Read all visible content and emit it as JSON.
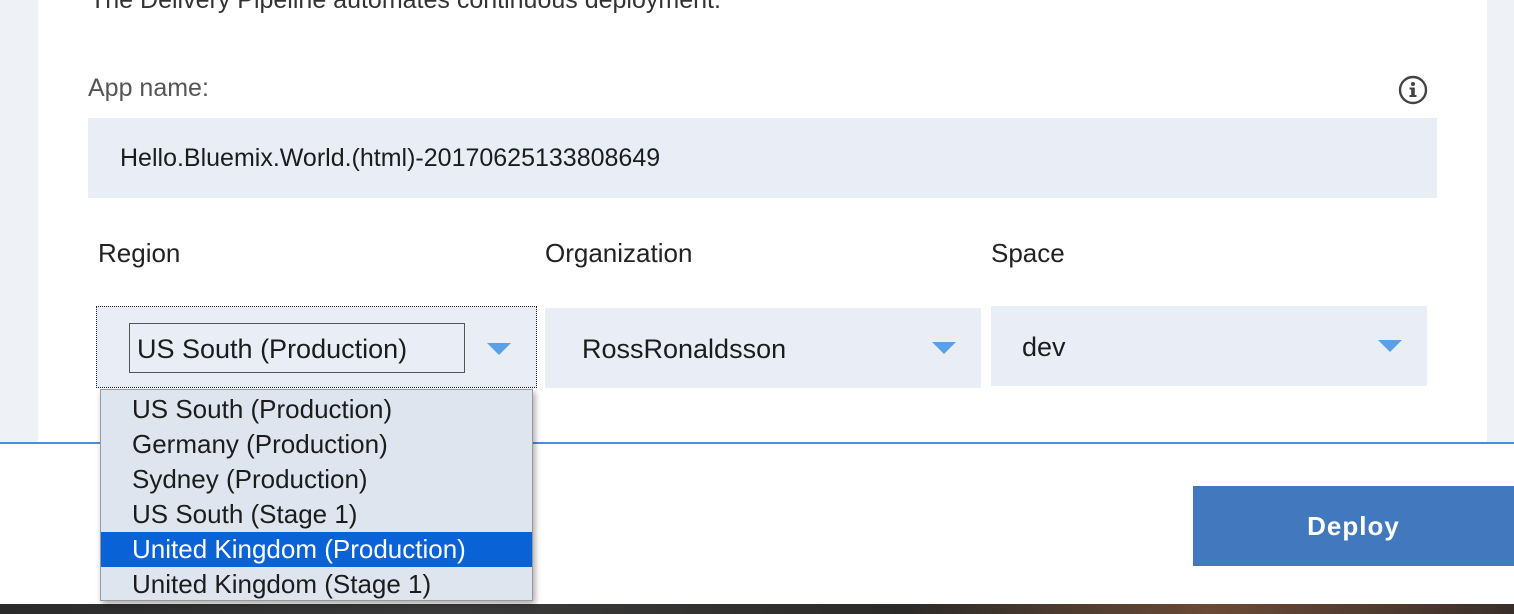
{
  "header": {
    "description": "The Delivery Pipeline automates continuous deployment."
  },
  "app_name": {
    "label": "App name:",
    "value": "Hello.Bluemix.World.(html)-20170625133808649",
    "info_icon": "info-circle-icon"
  },
  "fields": {
    "region_label": "Region",
    "organization_label": "Organization",
    "space_label": "Space"
  },
  "region_select": {
    "value": "US South (Production)",
    "options": [
      "US South (Production)",
      "Germany (Production)",
      "Sydney (Production)",
      "US South (Stage 1)",
      "United Kingdom (Production)",
      "United Kingdom (Stage 1)"
    ],
    "highlighted_index": 4
  },
  "organization_select": {
    "value": "RossRonaldsson"
  },
  "space_select": {
    "value": "dev"
  },
  "actions": {
    "deploy_label": "Deploy"
  },
  "colors": {
    "accent": "#4178be",
    "caret": "#5aa0e8",
    "highlight": "#0a63d6",
    "field_bg": "#e9eef6"
  }
}
